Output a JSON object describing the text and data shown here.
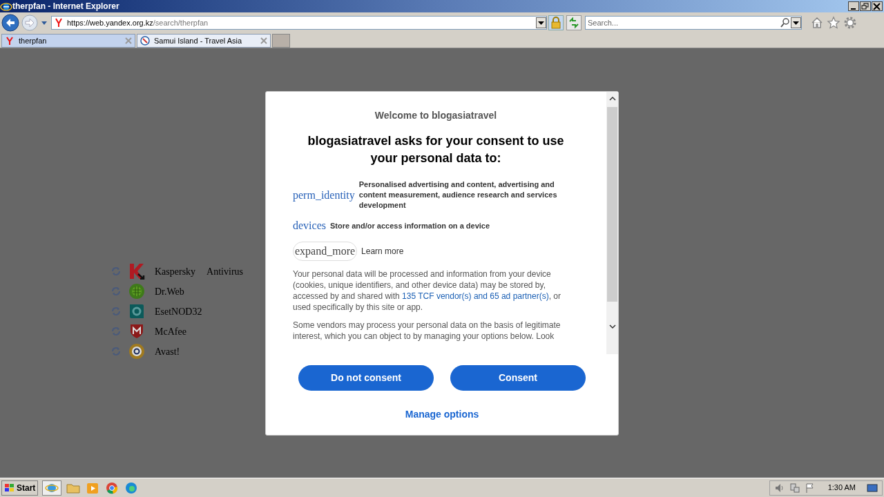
{
  "window": {
    "title": "therpfan - Internet Explorer"
  },
  "address_bar": {
    "url_host": "https://web.yandex.org.kz",
    "url_path": "/search/therpfan"
  },
  "search": {
    "placeholder": "Search..."
  },
  "tabs": [
    {
      "label": "therpfan",
      "selected": true,
      "kind": "yandex"
    },
    {
      "label": "Samui Island - Travel Asia",
      "selected": false,
      "kind": "compass"
    }
  ],
  "background_list": [
    {
      "label": "Kaspersky",
      "extra": "Antivirus",
      "kind": "kaspersky"
    },
    {
      "label": "Dr.Web",
      "kind": "drweb"
    },
    {
      "label": "EsetNOD32",
      "kind": "eset"
    },
    {
      "label": "McAfee",
      "kind": "mcafee"
    },
    {
      "label": "Avast!",
      "kind": "avast"
    }
  ],
  "dialog": {
    "welcome": "Welcome to blogasiatravel",
    "heading": "blogasiatravel asks for your consent to use your personal data to:",
    "purposes": [
      {
        "icon_text": "perm_identity",
        "text": "Personalised advertising and content, advertising and content measurement, audience research and services development"
      },
      {
        "icon_text": "devices",
        "text": "Store and/or access information on a device"
      }
    ],
    "learn_more": {
      "icon_text": "expand_more",
      "text": "Learn more"
    },
    "paragraphs": [
      {
        "before": "Your personal data will be processed and information from your device (cookies, unique identifiers, and other device data) may be stored by, accessed by and shared with ",
        "link": "135 TCF vendor(s) and 65 ad partner(s)",
        "after": ", or used specifically by this site or app."
      },
      {
        "before": "Some vendors may process your personal data on the basis of legitimate interest, which you can object to by managing your options below. Look"
      }
    ],
    "buttons": [
      "Do not consent",
      "Consent"
    ],
    "manage": "Manage options"
  },
  "taskbar": {
    "start": "Start",
    "clock": "1:30 AM"
  }
}
